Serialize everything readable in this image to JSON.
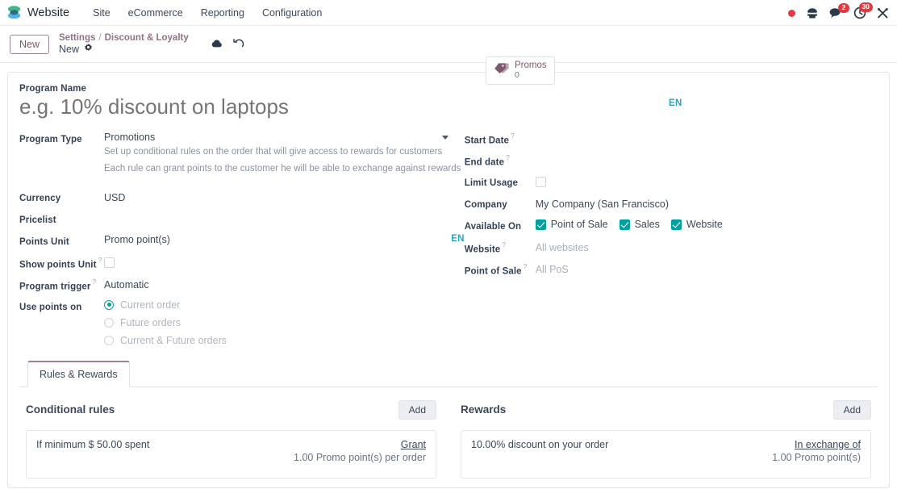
{
  "navbar": {
    "app_name": "Website",
    "logo_icon": "odoo-website-logo",
    "menus": [
      {
        "label": "Site"
      },
      {
        "label": "eCommerce"
      },
      {
        "label": "Reporting"
      },
      {
        "label": "Configuration"
      }
    ],
    "systray": [
      {
        "icon": "red-dot-indicator-icon",
        "badge": ""
      },
      {
        "icon": "phone-icon",
        "badge": ""
      },
      {
        "icon": "messages-chat-icon",
        "badge": "2"
      },
      {
        "icon": "activities-clock-icon",
        "badge": "30"
      },
      {
        "icon": "debug-tools-icon",
        "badge": ""
      }
    ],
    "accent_color": "#e03a3e"
  },
  "control_panel": {
    "new_button": "New",
    "breadcrumb_parent": "Settings",
    "breadcrumb_separator": "/",
    "breadcrumb_current": "Discount & Loyalty",
    "record_name": "New",
    "gear_icon": "gear-icon",
    "save_icon": "cloud-save-icon",
    "discard_icon": "undo-discard-icon",
    "stat_button": {
      "icon": "promo-tag-icon",
      "label": "Promos",
      "value": "0"
    }
  },
  "form": {
    "title_label": "Program Name",
    "title_placeholder": "e.g. 10% discount on laptops",
    "title_value": "",
    "lang_badge": "EN",
    "lang_badge_color": "#29a4bb",
    "left_fields": {
      "program_type_label": "Program Type",
      "program_type_value": "Promotions",
      "program_type_hint_line1": "Set up conditional rules on the order that will give access to rewards for customers",
      "program_type_hint_line2": "Each rule can grant points to the customer he will be able to exchange against rewards",
      "currency_label": "Currency",
      "currency_value": "USD",
      "pricelist_label": "Pricelist",
      "pricelist_value": "",
      "points_unit_label": "Points Unit",
      "points_unit_value": "Promo point(s)",
      "points_unit_lang": "EN",
      "show_points_unit_label": "Show points Unit",
      "show_points_unit_checked": false,
      "program_trigger_label": "Program trigger",
      "program_trigger_value": "Automatic",
      "use_points_on_label": "Use points on",
      "use_points_options": [
        {
          "label": "Current order",
          "selected": true
        },
        {
          "label": "Future orders",
          "selected": false
        },
        {
          "label": "Current & Future orders",
          "selected": false
        }
      ]
    },
    "right_fields": {
      "start_date_label": "Start Date",
      "start_date_value": "",
      "end_date_label": "End date",
      "end_date_value": "",
      "limit_usage_label": "Limit Usage",
      "limit_usage_checked": false,
      "company_label": "Company",
      "company_value": "My Company (San Francisco)",
      "available_on_label": "Available On",
      "available_on": [
        {
          "label": "Point of Sale",
          "checked": true
        },
        {
          "label": "Sales",
          "checked": true
        },
        {
          "label": "Website",
          "checked": true
        }
      ],
      "website_label": "Website",
      "website_value": "All websites",
      "pos_label": "Point of Sale",
      "pos_value": "All PoS"
    },
    "checkbox_color": "#00A09D"
  },
  "notebook": {
    "tabs": [
      {
        "label": "Rules & Rewards",
        "active": true
      }
    ],
    "conditional_rules": {
      "title": "Conditional rules",
      "add_label": "Add",
      "items": [
        {
          "condition": "If minimum $ 50.00 spent",
          "action_link": "Grant",
          "action_detail": "1.00 Promo point(s) per order"
        }
      ]
    },
    "rewards": {
      "title": "Rewards",
      "add_label": "Add",
      "items": [
        {
          "condition": "10.00% discount on your order",
          "action_link": "In exchange of",
          "action_detail": "1.00 Promo point(s)"
        }
      ]
    }
  }
}
